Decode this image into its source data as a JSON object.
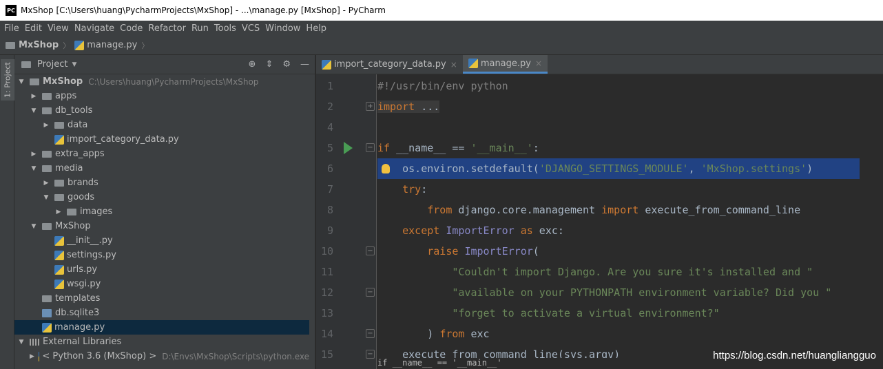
{
  "window": {
    "title": "MxShop [C:\\Users\\huang\\PycharmProjects\\MxShop] - ...\\manage.py [MxShop] - PyCharm",
    "logo": "PC"
  },
  "menu": [
    "File",
    "Edit",
    "View",
    "Navigate",
    "Code",
    "Refactor",
    "Run",
    "Tools",
    "VCS",
    "Window",
    "Help"
  ],
  "breadcrumb": {
    "project": "MxShop",
    "file": "manage.py"
  },
  "side_tab": "1: Project",
  "project_panel": {
    "title": "Project",
    "tree": [
      {
        "label": "MxShop",
        "path": "C:\\Users\\huang\\PycharmProjects\\MxShop",
        "indent": 0,
        "arrow": "down",
        "icon": "folder",
        "bold": true
      },
      {
        "label": "apps",
        "indent": 1,
        "arrow": "right",
        "icon": "folder"
      },
      {
        "label": "db_tools",
        "indent": 1,
        "arrow": "down",
        "icon": "folder"
      },
      {
        "label": "data",
        "indent": 2,
        "arrow": "right",
        "icon": "folder"
      },
      {
        "label": "import_category_data.py",
        "indent": 2,
        "arrow": "",
        "icon": "python"
      },
      {
        "label": "extra_apps",
        "indent": 1,
        "arrow": "right",
        "icon": "folder"
      },
      {
        "label": "media",
        "indent": 1,
        "arrow": "down",
        "icon": "folder"
      },
      {
        "label": "brands",
        "indent": 2,
        "arrow": "right",
        "icon": "folder"
      },
      {
        "label": "goods",
        "indent": 2,
        "arrow": "down",
        "icon": "folder"
      },
      {
        "label": "images",
        "indent": 3,
        "arrow": "right",
        "icon": "folder"
      },
      {
        "label": "MxShop",
        "indent": 1,
        "arrow": "down",
        "icon": "folder"
      },
      {
        "label": "__init__.py",
        "indent": 2,
        "arrow": "",
        "icon": "python"
      },
      {
        "label": "settings.py",
        "indent": 2,
        "arrow": "",
        "icon": "python"
      },
      {
        "label": "urls.py",
        "indent": 2,
        "arrow": "",
        "icon": "python"
      },
      {
        "label": "wsgi.py",
        "indent": 2,
        "arrow": "",
        "icon": "python"
      },
      {
        "label": "templates",
        "indent": 1,
        "arrow": "",
        "icon": "folder"
      },
      {
        "label": "db.sqlite3",
        "indent": 1,
        "arrow": "",
        "icon": "db"
      },
      {
        "label": "manage.py",
        "indent": 1,
        "arrow": "",
        "icon": "python",
        "selected": true
      },
      {
        "label": "External Libraries",
        "indent": 0,
        "arrow": "down",
        "icon": "library"
      },
      {
        "label": "< Python 3.6 (MxShop) >",
        "path": "D:\\Envs\\MxShop\\Scripts\\python.exe",
        "indent": 1,
        "arrow": "right",
        "icon": "python"
      }
    ]
  },
  "tabs": [
    {
      "label": "import_category_data.py",
      "active": false
    },
    {
      "label": "manage.py",
      "active": true
    }
  ],
  "code_lines": [
    {
      "n": "1",
      "html": "<span class='cm'>#!/usr/bin/env python</span>"
    },
    {
      "n": "2",
      "html": "<span class='fold-txt'><span class='kw'>import</span> ...</span>"
    },
    {
      "n": "4",
      "html": ""
    },
    {
      "n": "5",
      "html": "<span class='kw'>if</span> __name__ == <span class='str'>'__main__'</span>:"
    },
    {
      "n": "6",
      "html": "    os.environ.setdefault(<span class='str'>'DJANGO_SETTINGS_MODULE'</span>, <span class='str'>'MxShop.settings'</span>)"
    },
    {
      "n": "7",
      "html": "    <span class='kw'>try</span>:"
    },
    {
      "n": "8",
      "html": "        <span class='kw'>from</span> django.core.management <span class='kw'>import</span> execute_from_command_line"
    },
    {
      "n": "9",
      "html": "    <span class='kw'>except</span> <span class='ex'>ImportError</span> <span class='kw'>as</span> exc:"
    },
    {
      "n": "10",
      "html": "        <span class='kw'>raise</span> <span class='ex'>ImportError</span>("
    },
    {
      "n": "11",
      "html": "            <span class='str'>\"Couldn't import Django. Are you sure it's installed and \"</span>"
    },
    {
      "n": "12",
      "html": "            <span class='str'>\"available on your PYTHONPATH environment variable? Did you \"</span>"
    },
    {
      "n": "13",
      "html": "            <span class='str'>\"forget to activate a virtual environment?\"</span>"
    },
    {
      "n": "14",
      "html": "        ) <span class='kw'>from</span> exc"
    },
    {
      "n": "15",
      "html": "    execute_from_command_line(sys.argv)"
    }
  ],
  "status_crumb": "if __name__ == '__main__'",
  "watermark": "https://blog.csdn.net/huangliangguo"
}
